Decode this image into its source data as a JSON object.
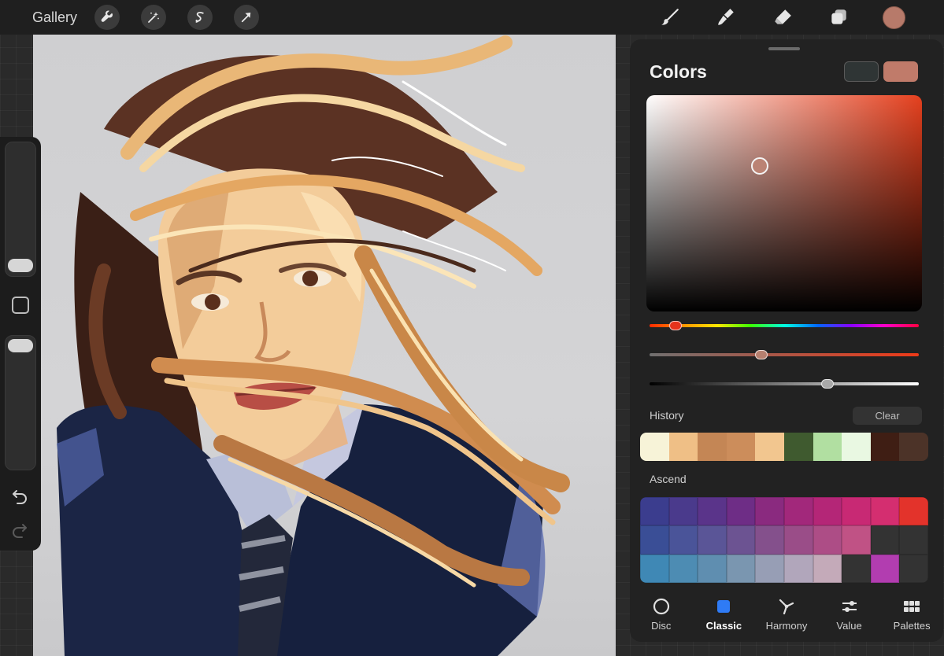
{
  "topbar": {
    "gallery_label": "Gallery",
    "left_tools": [
      "wrench-icon",
      "magic-wand-icon",
      "selection-icon",
      "transform-arrow-icon"
    ],
    "right_tools": [
      "brush-icon",
      "smudge-icon",
      "eraser-icon",
      "layers-icon"
    ],
    "active_color": "#b77a6a"
  },
  "colors_panel": {
    "title": "Colors",
    "previous_color": "#2f3535",
    "current_color": "#c07b6a",
    "history_label": "History",
    "clear_label": "Clear",
    "history_swatches": [
      "#f7f3d8",
      "#efbf86",
      "#c48655",
      "#cc8d5b",
      "#f2c68f",
      "#3f5a2f",
      "#b1dfa1",
      "#e9f8e2",
      "#3f1e14",
      "#4c3328"
    ],
    "palette_name": "Ascend",
    "palette": [
      "#3b3d8e",
      "#4a3a8c",
      "#5a348a",
      "#6e2d86",
      "#8a2a7f",
      "#a2287b",
      "#b42677",
      "#c82974",
      "#d42e70",
      "#e3332b",
      "#3a4e96",
      "#4a5499",
      "#5a5597",
      "#6c5392",
      "#84508c",
      "#9a4d88",
      "#ad4d86",
      "#c05285",
      "#333333",
      "#333333",
      "#3f88b5",
      "#4d8cb3",
      "#5f8eb0",
      "#7a96b0",
      "#979eb5",
      "#b1a6bb",
      "#c4aab9",
      "#333333",
      "#b23db0",
      "#333333"
    ],
    "tabs": [
      {
        "label": "Disc",
        "icon": "circle-outline-icon"
      },
      {
        "label": "Classic",
        "icon": "square-fill-icon"
      },
      {
        "label": "Harmony",
        "icon": "harmony-icon"
      },
      {
        "label": "Value",
        "icon": "sliders-icon"
      },
      {
        "label": "Palettes",
        "icon": "grid-icon"
      }
    ],
    "active_tab": "Classic",
    "hue_value": 0.08,
    "saturation_value": 0.42,
    "brightness_value": 0.66
  },
  "sidebar": {
    "brush_size_value": 0.08,
    "opacity_value": 0.92
  }
}
